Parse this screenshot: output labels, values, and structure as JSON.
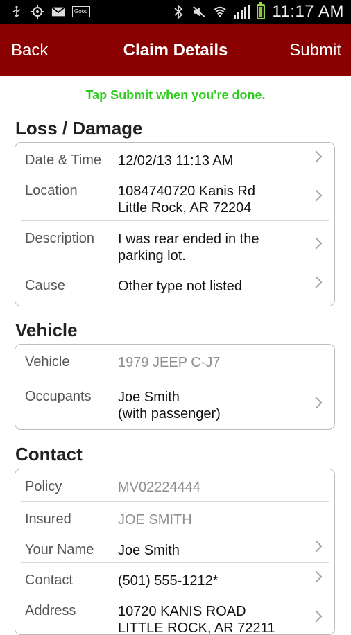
{
  "status_bar": {
    "notification_icons": [
      "usb-icon",
      "gps-icon",
      "gmail-icon",
      "good-app-icon"
    ],
    "good_label": "Good",
    "system_icons": [
      "bluetooth-icon",
      "mute-icon",
      "wifi-icon",
      "signal-icon",
      "battery-charging-icon"
    ],
    "time": "11:17 AM"
  },
  "nav": {
    "back": "Back",
    "title": "Claim Details",
    "submit": "Submit"
  },
  "hint": "Tap Submit when you're done.",
  "sections": {
    "loss": {
      "title": "Loss / Damage",
      "rows": [
        {
          "label": "Date & Time",
          "value": "12/02/13 11:13 AM",
          "editable": true
        },
        {
          "label": "Location",
          "value": "1084740720 Kanis Rd\nLittle Rock, AR 72204",
          "editable": true
        },
        {
          "label": "Description",
          "value": "I was rear ended in the\nparking lot.",
          "editable": true
        },
        {
          "label": "Cause",
          "value": "Other type not listed",
          "editable": true
        }
      ]
    },
    "vehicle": {
      "title": "Vehicle",
      "rows": [
        {
          "label": "Vehicle",
          "value": "1979 JEEP C-J7",
          "editable": false
        },
        {
          "label": "Occupants",
          "value": "Joe Smith\n(with passenger)",
          "editable": true
        }
      ]
    },
    "contact": {
      "title": "Contact",
      "rows": [
        {
          "label": "Policy",
          "value": "MV02224444",
          "editable": false
        },
        {
          "label": "Insured",
          "value": "JOE SMITH",
          "editable": false
        },
        {
          "label": "Your Name",
          "value": "Joe Smith",
          "editable": true
        },
        {
          "label": "Contact",
          "value": "(501) 555-1212*",
          "editable": true
        },
        {
          "label": "Address",
          "value": "10720 KANIS ROAD\nLITTLE ROCK, AR 72211",
          "editable": true
        }
      ]
    }
  },
  "colors": {
    "nav_background": "#8b0000",
    "hint_text": "#2ecc1f"
  }
}
